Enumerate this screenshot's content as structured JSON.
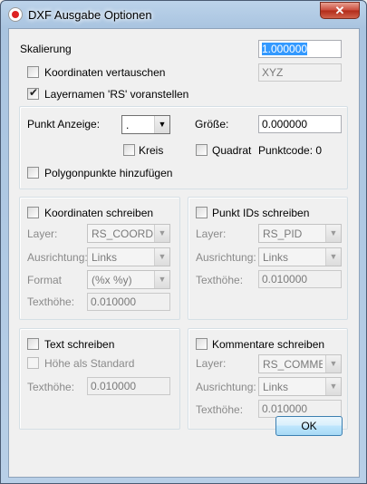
{
  "window": {
    "title": "DXF Ausgabe Optionen",
    "close_label": "✕"
  },
  "skalierung": {
    "label": "Skalierung",
    "value": "1.000000"
  },
  "koordinaten_vertauschen": {
    "label": "Koordinaten vertauschen",
    "checked": false,
    "value": "XYZ"
  },
  "layernamen": {
    "label": "Layernamen 'RS' voranstellen",
    "checked": true
  },
  "punkt": {
    "anzeige_label": "Punkt Anzeige:",
    "anzeige_value": ".",
    "groesse_label": "Größe:",
    "groesse_value": "0.000000",
    "kreis_label": "Kreis",
    "quadrat_label": "Quadrat",
    "punktcode_label": "Punktcode: 0",
    "polygon_label": "Polygonpunkte hinzufügen"
  },
  "koordinaten_group": {
    "header": "Koordinaten schreiben",
    "layer_label": "Layer:",
    "layer_value": "RS_COORD",
    "ausrichtung_label": "Ausrichtung:",
    "ausrichtung_value": "Links",
    "format_label": "Format",
    "format_value": "(%x %y)",
    "texthoehe_label": "Texthöhe:",
    "texthoehe_value": "0.010000"
  },
  "punkt_ids_group": {
    "header": "Punkt IDs schreiben",
    "layer_label": "Layer:",
    "layer_value": "RS_PID",
    "ausrichtung_label": "Ausrichtung:",
    "ausrichtung_value": "Links",
    "texthoehe_label": "Texthöhe:",
    "texthoehe_value": "0.010000"
  },
  "text_group": {
    "header": "Text schreiben",
    "hoehe_label": "Höhe als Standard",
    "texthoehe_label": "Texthöhe:",
    "texthoehe_value": "0.010000"
  },
  "kommentare_group": {
    "header": "Kommentare schreiben",
    "layer_label": "Layer:",
    "layer_value": "RS_COMMENT",
    "ausrichtung_label": "Ausrichtung:",
    "ausrichtung_value": "Links",
    "texthoehe_label": "Texthöhe:",
    "texthoehe_value": "0.010000"
  },
  "ok_label": "OK"
}
